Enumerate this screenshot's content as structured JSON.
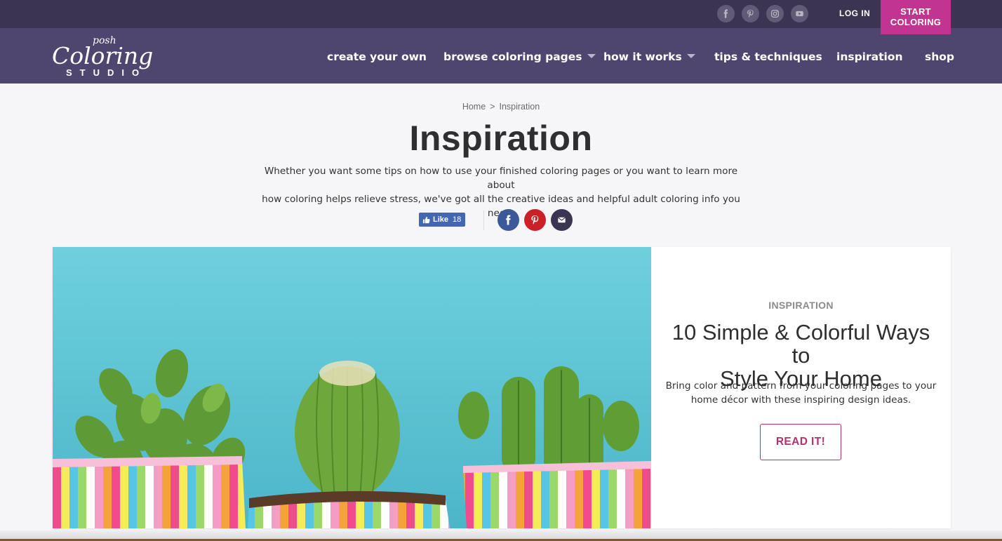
{
  "topbar": {
    "social": [
      {
        "name": "facebook-icon"
      },
      {
        "name": "pinterest-icon"
      },
      {
        "name": "instagram-icon"
      },
      {
        "name": "youtube-icon"
      }
    ],
    "login_label": "LOG IN",
    "start_label_line1": "START",
    "start_label_line2": "COLORING",
    "bg_color": "#3c3552",
    "start_color": "#c1348f"
  },
  "logo": {
    "small": "posh",
    "main": "Coloring",
    "sub": "STUDIO"
  },
  "nav": {
    "items": [
      {
        "label": "create your own",
        "dropdown": false
      },
      {
        "label": "browse coloring pages",
        "dropdown": true
      },
      {
        "label": "how it works",
        "dropdown": true
      },
      {
        "label": "tips & techniques",
        "dropdown": false
      },
      {
        "label": "inspiration",
        "dropdown": false
      },
      {
        "label": "shop",
        "dropdown": false
      }
    ],
    "bg_color": "#4f4670"
  },
  "breadcrumb": {
    "home": "Home",
    "separator": ">",
    "current": "Inspiration"
  },
  "page": {
    "title": "Inspiration",
    "intro_line1": "Whether you want some tips on how to use your finished coloring pages or you want to learn more about",
    "intro_line2": "how coloring helps relieve stress, we've got all the creative ideas and helpful adult coloring info you need."
  },
  "share": {
    "like_label": "Like",
    "like_count": "18",
    "buttons": [
      {
        "name": "facebook-share-icon",
        "color": "#3b5998"
      },
      {
        "name": "pinterest-share-icon",
        "color": "#cb2027"
      },
      {
        "name": "email-share-icon",
        "color": "#3c3552"
      }
    ]
  },
  "featured": {
    "category": "INSPIRATION",
    "title_line1": "10 Simple & Colorful Ways to",
    "title_line2": "Style Your Home",
    "desc_line1": "Bring color and pattern from your coloring pages to your",
    "desc_line2": "home décor with these inspiring design ideas.",
    "button_label": "READ IT!",
    "accent_color": "#b0336e",
    "image_subject": "three cactus plants in rainbow striped pots"
  }
}
